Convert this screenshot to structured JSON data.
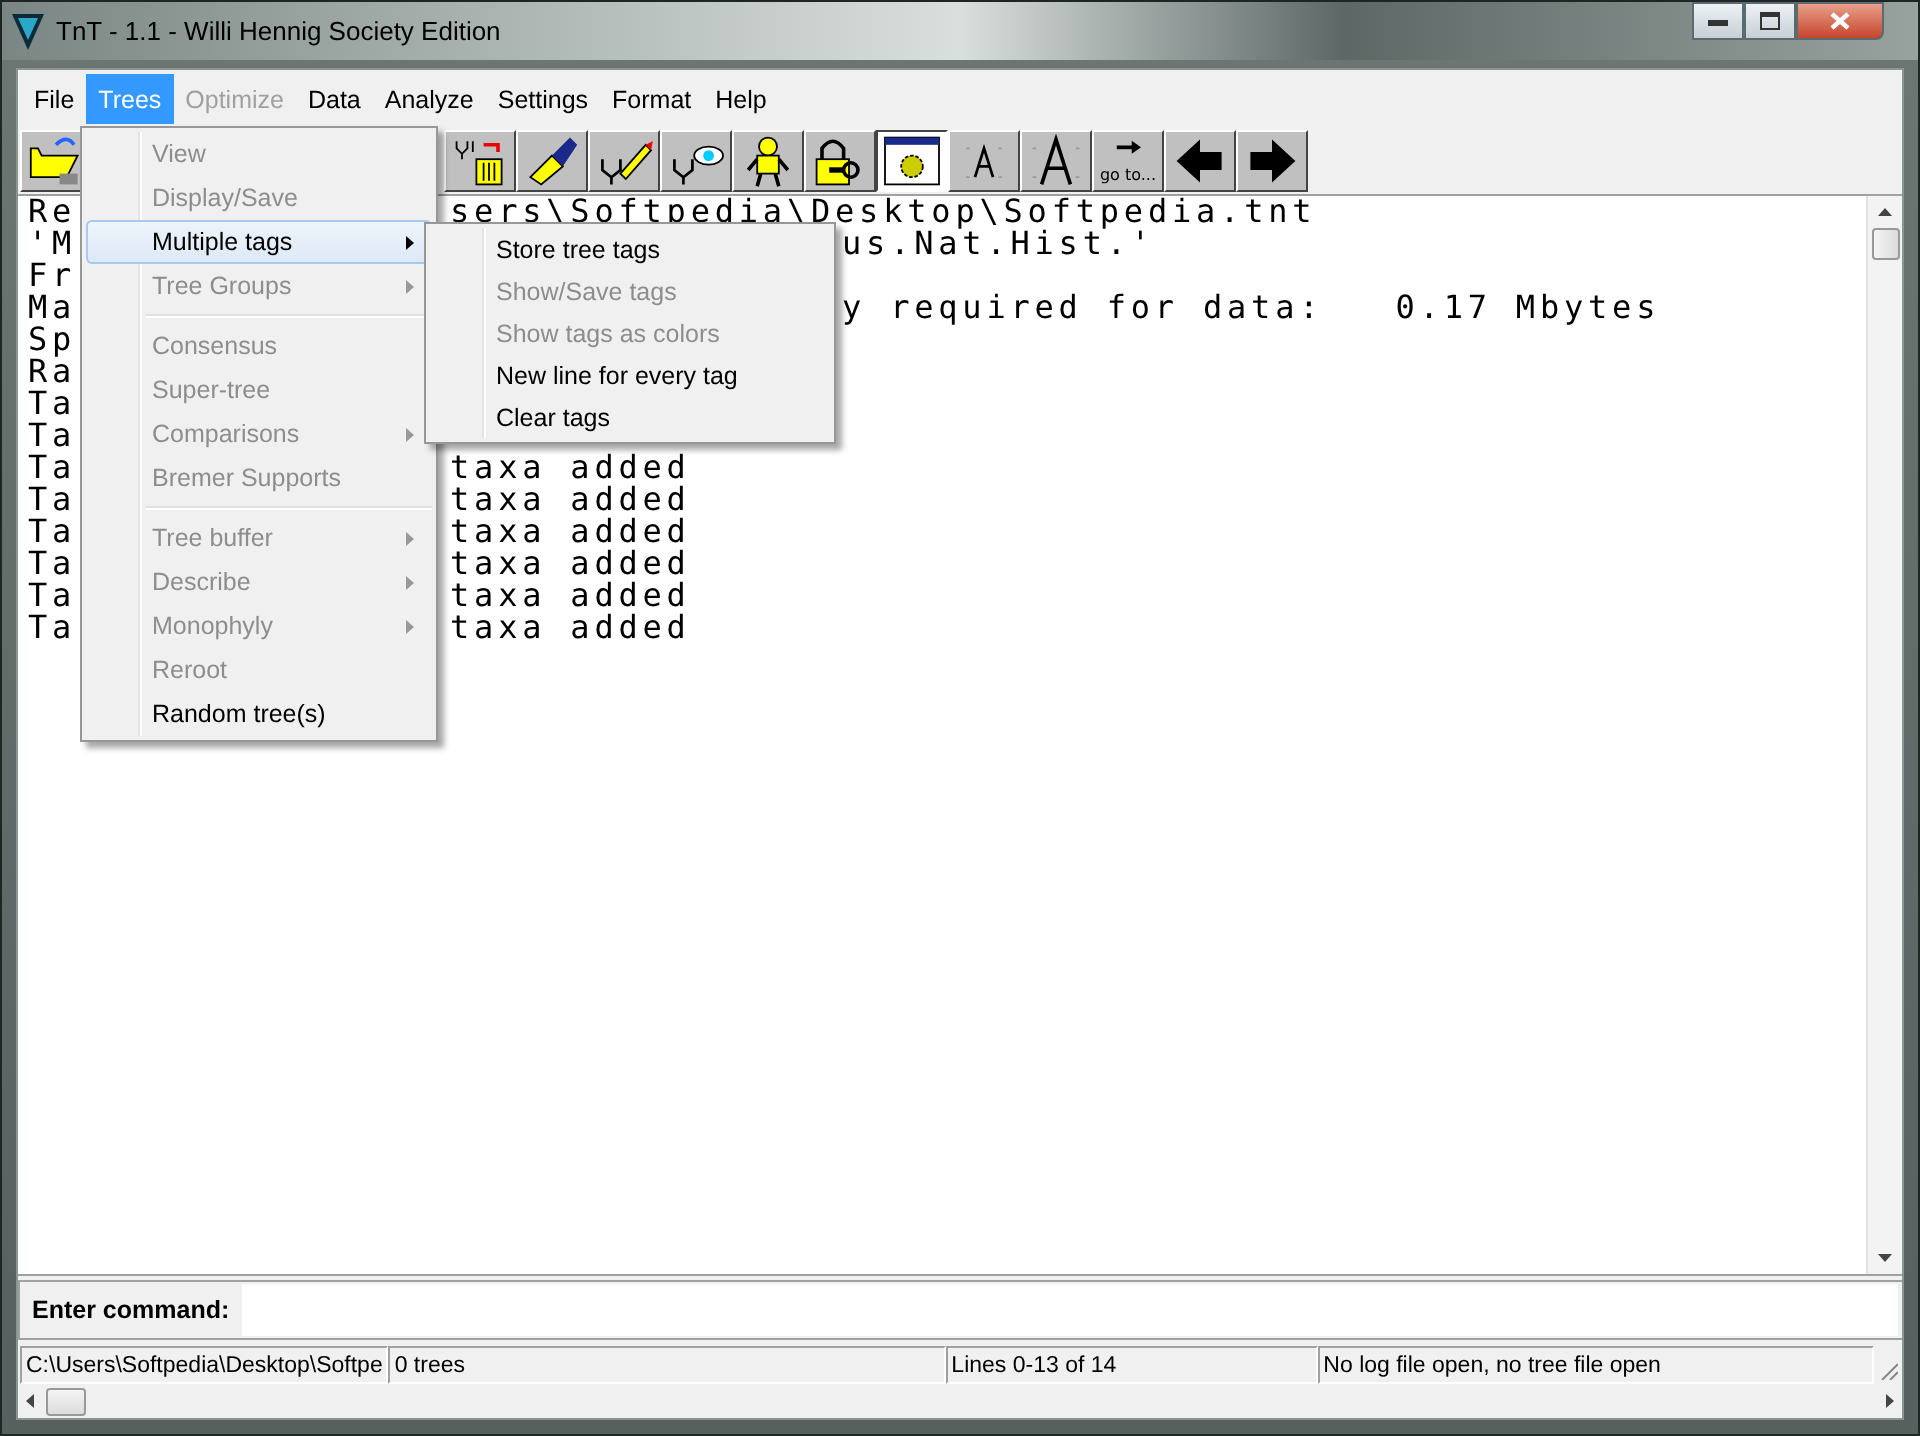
{
  "window": {
    "title": "TnT - 1.1 - Willi Hennig Society Edition"
  },
  "menubar": [
    {
      "label": "File",
      "selected": false,
      "disabled": false
    },
    {
      "label": "Trees",
      "selected": true,
      "disabled": false
    },
    {
      "label": "Optimize",
      "selected": false,
      "disabled": true
    },
    {
      "label": "Data",
      "selected": false,
      "disabled": false
    },
    {
      "label": "Analyze",
      "selected": false,
      "disabled": false
    },
    {
      "label": "Settings",
      "selected": false,
      "disabled": false
    },
    {
      "label": "Format",
      "selected": false,
      "disabled": false
    },
    {
      "label": "Help",
      "selected": false,
      "disabled": false
    }
  ],
  "toolbar": [
    {
      "kind": "folder",
      "pressed": false
    },
    {
      "kind": "tree-trash",
      "pressed": false
    },
    {
      "kind": "brush",
      "pressed": false
    },
    {
      "kind": "tree-pencil",
      "pressed": false
    },
    {
      "kind": "tree-eye",
      "pressed": false
    },
    {
      "kind": "figure",
      "pressed": false
    },
    {
      "kind": "lock-key",
      "pressed": false
    },
    {
      "kind": "window-gear",
      "pressed": true
    },
    {
      "kind": "font-small",
      "pressed": false
    },
    {
      "kind": "font-large",
      "pressed": false
    },
    {
      "kind": "goto",
      "pressed": false,
      "label": "go to..."
    },
    {
      "kind": "arrow-left",
      "pressed": false
    },
    {
      "kind": "arrow-right",
      "pressed": false
    }
  ],
  "output": {
    "lines": [
      {
        "left": "Re",
        "right": "sers\\Softpedia\\Desktop\\Softpedia.tnt"
      },
      {
        "left": "'M",
        "right": "us.Nat.Hist.'"
      },
      {
        "left": "Fr"
      },
      {
        "left": "Ma",
        "right": "y required for data:   0.17 Mbytes"
      },
      {
        "left": "Sp"
      },
      {
        "left": "Ra"
      },
      {
        "left": "Ta"
      },
      {
        "left": "Ta"
      },
      {
        "left": "Ta",
        "right": "taxa added"
      },
      {
        "left": "Ta",
        "right": "taxa added"
      },
      {
        "left": "Ta",
        "right": "taxa added"
      },
      {
        "left": "Ta",
        "right": "taxa added"
      },
      {
        "left": "Ta",
        "right": "taxa added"
      },
      {
        "left": "Ta",
        "right": "taxa added"
      }
    ]
  },
  "trees_menu": [
    {
      "kind": "item",
      "label": "View",
      "disabled": true,
      "selected": false,
      "submenu": false
    },
    {
      "kind": "item",
      "label": "Display/Save",
      "disabled": true,
      "selected": false,
      "submenu": false
    },
    {
      "kind": "item",
      "label": "Multiple tags",
      "disabled": false,
      "selected": true,
      "submenu": true
    },
    {
      "kind": "item",
      "label": "Tree Groups",
      "disabled": true,
      "selected": false,
      "submenu": true
    },
    {
      "kind": "separator"
    },
    {
      "kind": "item",
      "label": "Consensus",
      "disabled": true,
      "selected": false,
      "submenu": false
    },
    {
      "kind": "item",
      "label": "Super-tree",
      "disabled": true,
      "selected": false,
      "submenu": false
    },
    {
      "kind": "item",
      "label": "Comparisons",
      "disabled": true,
      "selected": false,
      "submenu": true
    },
    {
      "kind": "item",
      "label": "Bremer Supports",
      "disabled": true,
      "selected": false,
      "submenu": false
    },
    {
      "kind": "separator"
    },
    {
      "kind": "item",
      "label": "Tree buffer",
      "disabled": true,
      "selected": false,
      "submenu": true
    },
    {
      "kind": "item",
      "label": "Describe",
      "disabled": true,
      "selected": false,
      "submenu": true
    },
    {
      "kind": "item",
      "label": "Monophyly",
      "disabled": true,
      "selected": false,
      "submenu": true
    },
    {
      "kind": "item",
      "label": "Reroot",
      "disabled": true,
      "selected": false,
      "submenu": false
    },
    {
      "kind": "item",
      "label": "Random tree(s)",
      "disabled": false,
      "selected": false,
      "submenu": false
    }
  ],
  "tags_submenu": [
    {
      "label": "Store tree tags",
      "disabled": false
    },
    {
      "label": "Show/Save tags",
      "disabled": true
    },
    {
      "label": "Show tags as colors",
      "disabled": true
    },
    {
      "label": "New line for every tag",
      "disabled": false
    },
    {
      "label": "Clear tags",
      "disabled": false
    }
  ],
  "command": {
    "label": "Enter command:"
  },
  "status_bar": [
    "C:\\Users\\Softpedia\\Desktop\\Softpe",
    "0 trees",
    "Lines 0-13 of 14",
    "No log file open, no tree file open"
  ]
}
